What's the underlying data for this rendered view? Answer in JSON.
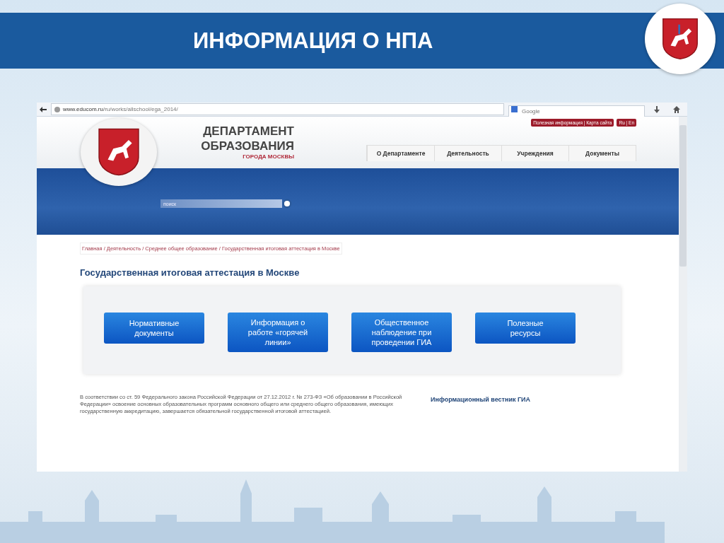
{
  "slide": {
    "title": "ИНФОРМАЦИЯ О НПА"
  },
  "browser": {
    "url_host": "www.educom.ru",
    "url_path": "/ru/works/allschool/ega_2014/",
    "search_placeholder": "Google"
  },
  "site": {
    "org_lines": [
      "ДЕПАРТАМЕНТ",
      "ОБРАЗОВАНИЯ"
    ],
    "org_city": "ГОРОДА МОСКВЫ",
    "top_links": [
      "Полезная информация | Карта сайта",
      "Ru | En"
    ],
    "nav": [
      "О Департаменте",
      "Деятельность",
      "Учреждения",
      "Документы"
    ],
    "search_placeholder": "поиск"
  },
  "breadcrumb": "Главная / Деятельность / Среднее общее образование / Государственная итоговая аттестация в Москве",
  "heading": "Государственная итоговая аттестация в Москве",
  "buttons": [
    "Нормативные документы",
    "Информация о работе «горячей линии»",
    "Общественное наблюдение при проведении ГИА",
    "Полезные ресурсы"
  ],
  "paragraph": "В соответствии со ст. 59 Федерального закона Российской Федерации от 27.12.2012 г. № 273-ФЗ «Об образовании в Российской Федерации» освоение основных образовательных программ основного общего или среднего общего образования, имеющих государственную аккредитацию, завершается обязательной государственной итоговой аттестацией.",
  "side_link": "Информационный вестник ГИА"
}
